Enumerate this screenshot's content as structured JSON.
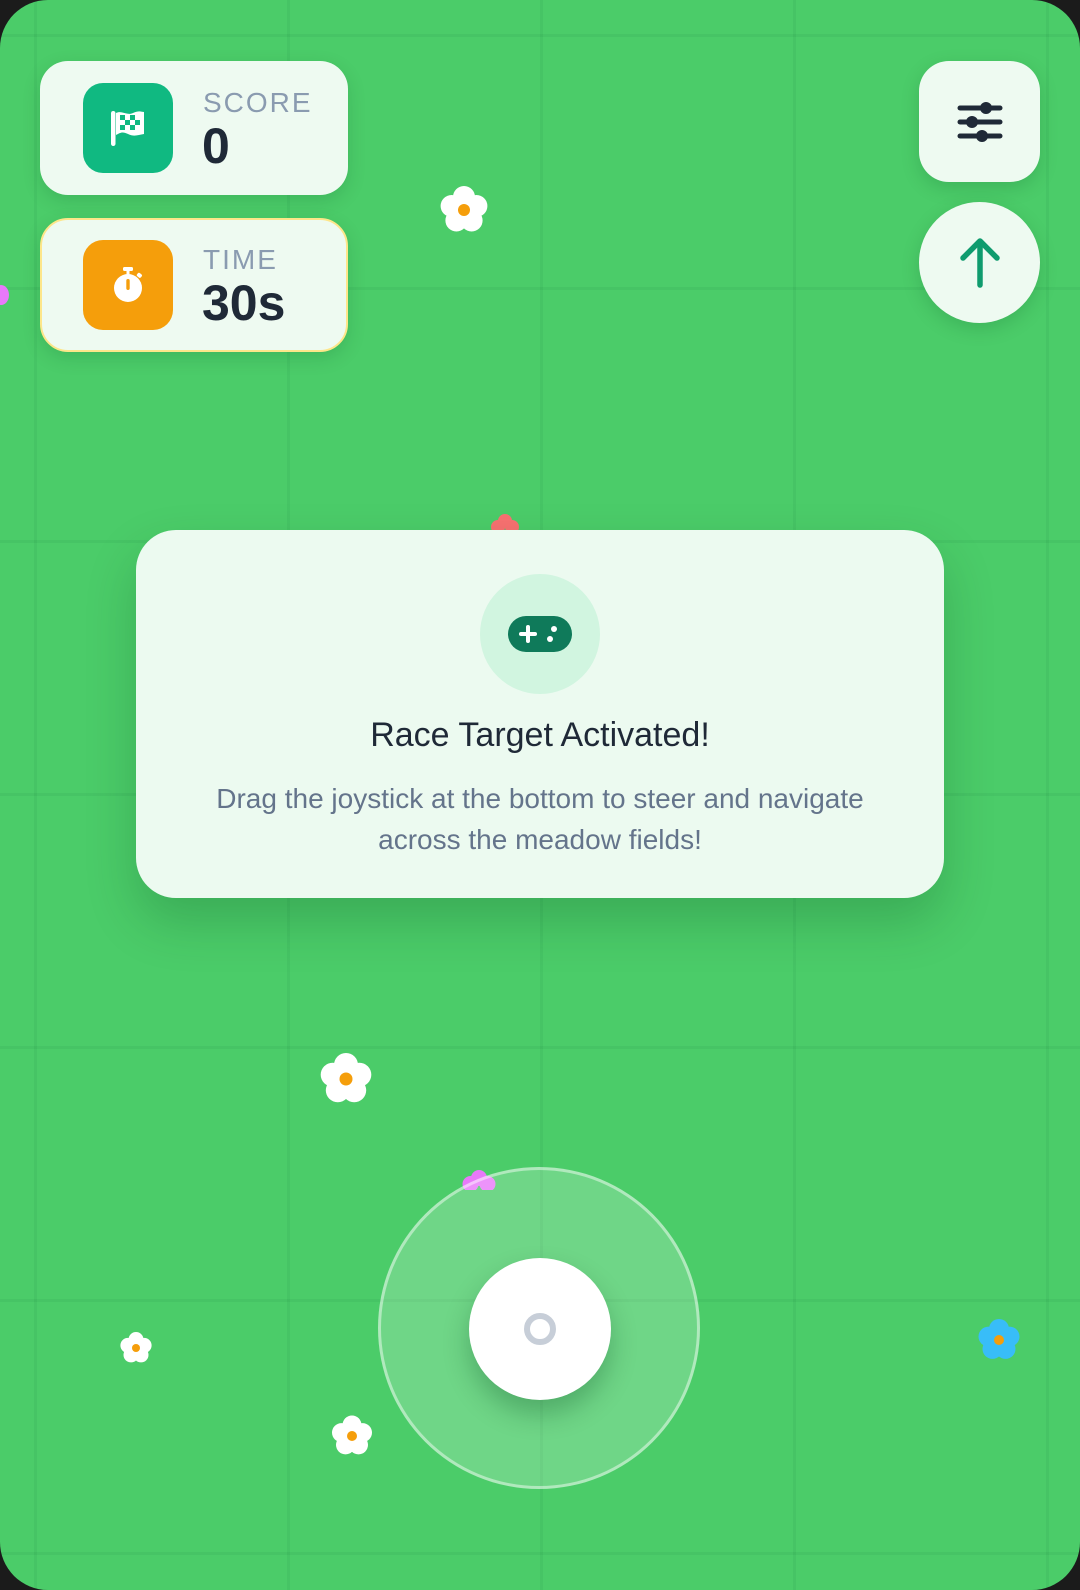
{
  "hud": {
    "score": {
      "label": "SCORE",
      "value": "0",
      "icon": "checkered-flag-icon",
      "color": "#10b981"
    },
    "time": {
      "label": "TIME",
      "value": "30s",
      "icon": "stopwatch-icon",
      "color": "#f59e0b"
    }
  },
  "controls": {
    "settings_icon": "sliders-icon",
    "boost_icon": "arrow-up-icon",
    "joystick": "joystick"
  },
  "dialog": {
    "icon": "gamepad-icon",
    "title": "Race Target Activated!",
    "body": "Drag the joystick at the bottom to steer and navigate across the meadow fields!"
  },
  "colors": {
    "meadow": "#4bcc69",
    "card": "#eefaf1",
    "accent_green": "#0f9b6e",
    "text_dark": "#1f2937",
    "text_muted": "#64748b"
  }
}
